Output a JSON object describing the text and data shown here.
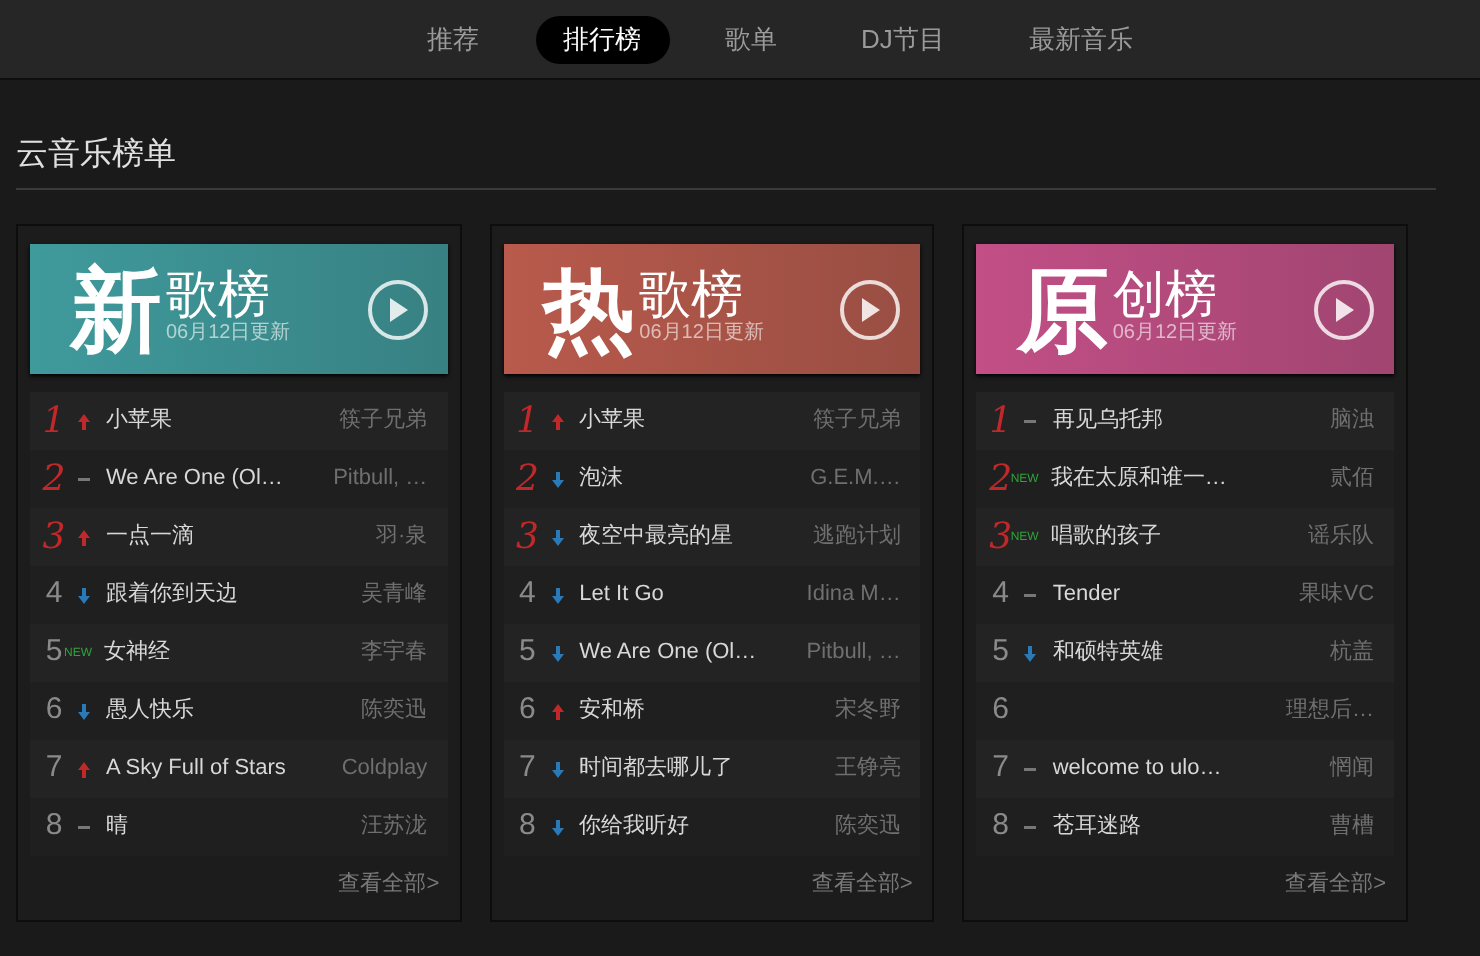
{
  "tabs": [
    {
      "label": "推荐",
      "selected": false
    },
    {
      "label": "排行榜",
      "selected": true
    },
    {
      "label": "歌单",
      "selected": false
    },
    {
      "label": "DJ节目",
      "selected": false
    },
    {
      "label": "最新音乐",
      "selected": false
    }
  ],
  "section_title": "云音乐榜单",
  "charts": [
    {
      "big_char": "新",
      "name": "歌榜",
      "updated": "06月12日更新",
      "color": "#3f9a9c",
      "more": "查看全部>",
      "rows": [
        {
          "rank": "1",
          "top": true,
          "kind": "up",
          "title": "小苹果",
          "artist": "筷子兄弟"
        },
        {
          "rank": "2",
          "top": true,
          "kind": "same",
          "title": "We Are One (Ol…",
          "artist": "Pitbull, …"
        },
        {
          "rank": "3",
          "top": true,
          "kind": "up",
          "title": "一点一滴",
          "artist": "羽·泉"
        },
        {
          "rank": "4",
          "top": false,
          "kind": "down",
          "title": "跟着你到天边",
          "artist": "吴青峰"
        },
        {
          "rank": "5",
          "top": false,
          "kind": "new",
          "badge": "NEW",
          "title": "女神经",
          "artist": "李宇春"
        },
        {
          "rank": "6",
          "top": false,
          "kind": "down",
          "title": "愚人快乐",
          "artist": "陈奕迅"
        },
        {
          "rank": "7",
          "top": false,
          "kind": "up",
          "title": "A Sky Full of Stars",
          "artist": "Coldplay"
        },
        {
          "rank": "8",
          "top": false,
          "kind": "same",
          "title": "晴",
          "artist": "汪苏泷"
        }
      ]
    },
    {
      "big_char": "热",
      "name": "歌榜",
      "updated": "06月12日更新",
      "color": "#b85a4c",
      "more": "查看全部>",
      "rows": [
        {
          "rank": "1",
          "top": true,
          "kind": "up",
          "title": "小苹果",
          "artist": "筷子兄弟"
        },
        {
          "rank": "2",
          "top": true,
          "kind": "down",
          "title": "泡沫",
          "artist": "G.E.M.…"
        },
        {
          "rank": "3",
          "top": true,
          "kind": "down",
          "title": "夜空中最亮的星",
          "artist": "逃跑计划"
        },
        {
          "rank": "4",
          "top": false,
          "kind": "down",
          "title": "Let It Go",
          "artist": "Idina M…"
        },
        {
          "rank": "5",
          "top": false,
          "kind": "down",
          "title": "We Are One (Ol…",
          "artist": "Pitbull, …"
        },
        {
          "rank": "6",
          "top": false,
          "kind": "up",
          "title": "安和桥",
          "artist": "宋冬野"
        },
        {
          "rank": "7",
          "top": false,
          "kind": "down",
          "title": "时间都去哪儿了",
          "artist": "王铮亮"
        },
        {
          "rank": "8",
          "top": false,
          "kind": "down",
          "title": "你给我听好",
          "artist": "陈奕迅"
        }
      ]
    },
    {
      "big_char": "原",
      "name": "创榜",
      "updated": "06月12日更新",
      "color": "#c24f86",
      "more": "查看全部>",
      "rows": [
        {
          "rank": "1",
          "top": true,
          "kind": "same",
          "title": "再见乌托邦",
          "artist": "脑浊"
        },
        {
          "rank": "2",
          "top": true,
          "kind": "new",
          "badge": "NEW",
          "title": "我在太原和谁一…",
          "artist": "贰佰"
        },
        {
          "rank": "3",
          "top": true,
          "kind": "new",
          "badge": "NEW",
          "title": "唱歌的孩子",
          "artist": "谣乐队"
        },
        {
          "rank": "4",
          "top": false,
          "kind": "same",
          "title": "Tender",
          "artist": "果味VC"
        },
        {
          "rank": "5",
          "top": false,
          "kind": "down",
          "title": "和硕特英雄",
          "artist": "杭盖"
        },
        {
          "rank": "6",
          "top": false,
          "artist": "理想后…"
        },
        {
          "rank": "7",
          "top": false,
          "kind": "same",
          "title": "welcome to ulo…",
          "artist": "惘闻"
        },
        {
          "rank": "8",
          "top": false,
          "kind": "same",
          "title": "苍耳迷路",
          "artist": "曹槽"
        }
      ]
    }
  ]
}
